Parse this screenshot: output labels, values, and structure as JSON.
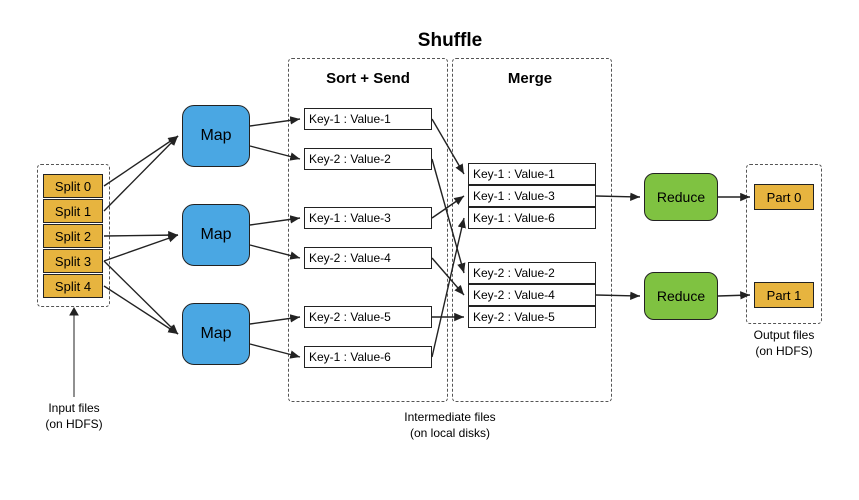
{
  "title_main": "Shuffle",
  "title_sort": "Sort + Send",
  "title_merge": "Merge",
  "caption_input": "Input files\n(on HDFS)",
  "caption_intermediate": "Intermediate files\n(on local disks)",
  "caption_output": "Output files\n(on HDFS)",
  "splits": [
    "Split 0",
    "Split 1",
    "Split 2",
    "Split 3",
    "Split 4"
  ],
  "map_label": "Map",
  "reduce_label": "Reduce",
  "kv": [
    "Key-1 : Value-1",
    "Key-2 : Value-2",
    "Key-1 : Value-3",
    "Key-2 : Value-4",
    "Key-2 : Value-5",
    "Key-1 : Value-6"
  ],
  "merge_top": [
    "Key-1 : Value-1",
    "Key-1 : Value-3",
    "Key-1 : Value-6"
  ],
  "merge_bottom": [
    "Key-2 : Value-2",
    "Key-2 : Value-4",
    "Key-2 : Value-5"
  ],
  "parts": [
    "Part 0",
    "Part 1"
  ],
  "chart_data": {
    "type": "diagram",
    "description": "MapReduce data flow: input splits on HDFS -> Map tasks -> intermediate key-value pairs (sort + send) -> merge by key -> Reduce tasks -> output part files on HDFS",
    "input_splits": [
      "Split 0",
      "Split 1",
      "Split 2",
      "Split 3",
      "Split 4"
    ],
    "mappers": 3,
    "mapper_outputs": [
      [
        "Key-1 : Value-1",
        "Key-2 : Value-2"
      ],
      [
        "Key-1 : Value-3",
        "Key-2 : Value-4"
      ],
      [
        "Key-2 : Value-5",
        "Key-1 : Value-6"
      ]
    ],
    "merged_groups": [
      {
        "key": "Key-1",
        "values": [
          "Value-1",
          "Value-3",
          "Value-6"
        ],
        "reducer": 0
      },
      {
        "key": "Key-2",
        "values": [
          "Value-2",
          "Value-4",
          "Value-5"
        ],
        "reducer": 1
      }
    ],
    "reducers": 2,
    "output_parts": [
      "Part 0",
      "Part 1"
    ],
    "stages": [
      "Input files (on HDFS)",
      "Map",
      "Shuffle: Sort + Send",
      "Shuffle: Merge",
      "Reduce",
      "Output files (on HDFS)"
    ]
  }
}
